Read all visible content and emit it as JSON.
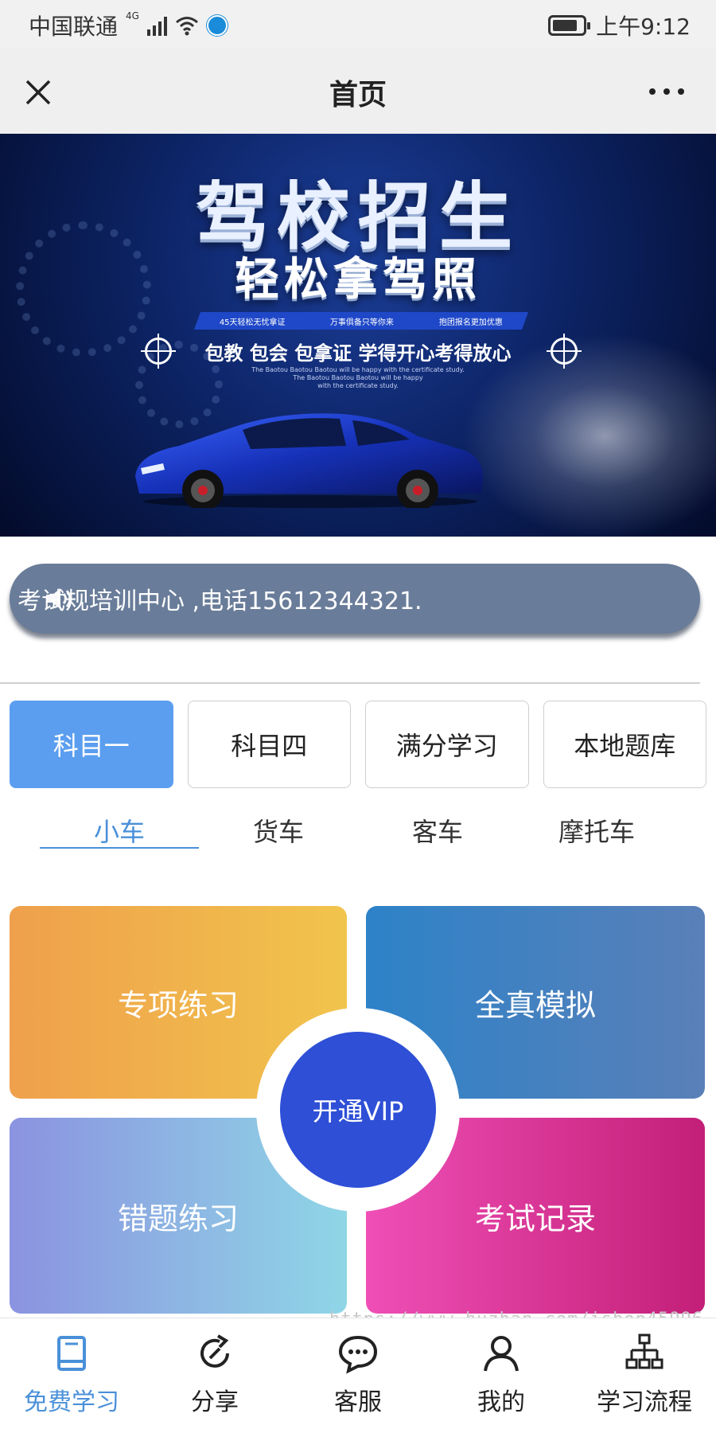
{
  "status_bar": {
    "carrier": "中国联通",
    "network": "4G",
    "time": "上午9:12"
  },
  "header": {
    "title": "首页",
    "close_icon": "close-icon",
    "more_icon": "more-icon"
  },
  "banner": {
    "title": "驾校招生",
    "subtitle": "轻松拿驾照",
    "tags": [
      "45天轻松无忧拿证",
      "万事俱备只等你来",
      "抱团报名更加优惠"
    ],
    "slogan": "包教 包会 包拿证 学得开心考得放心",
    "english_lines": [
      "The Baotou Baotou Baotou will be happy with the certificate study.",
      "The Baotou Baotou Baotou will be happy",
      "with the certificate study."
    ]
  },
  "notice": {
    "text": "考试规培训中心 ,电话15612344321.",
    "icon": "speaker-icon"
  },
  "subject_tabs": [
    {
      "label": "科目一",
      "active": true
    },
    {
      "label": "科目四",
      "active": false
    },
    {
      "label": "满分学习",
      "active": false
    },
    {
      "label": "本地题库",
      "active": false
    }
  ],
  "vehicle_tabs": [
    {
      "label": "小车",
      "active": true
    },
    {
      "label": "货车",
      "active": false
    },
    {
      "label": "客车",
      "active": false
    },
    {
      "label": "摩托车",
      "active": false
    }
  ],
  "cards": {
    "special_practice": "专项练习",
    "full_simulation": "全真模拟",
    "wrong_practice": "错题练习",
    "exam_records": "考试记录",
    "vip": "开通VIP"
  },
  "watermark": "https://www.huzhan.com/ishop45996",
  "colors": {
    "accent_blue": "#4a90d9",
    "tab_active_bg": "#5b9eef",
    "notice_bg": "#697c99",
    "vip_bg": "#2e4fd6"
  },
  "bottom_nav": [
    {
      "label": "免费学习",
      "icon": "book-icon",
      "active": true
    },
    {
      "label": "分享",
      "icon": "share-icon",
      "active": false
    },
    {
      "label": "客服",
      "icon": "chat-icon",
      "active": false
    },
    {
      "label": "我的",
      "icon": "user-icon",
      "active": false
    },
    {
      "label": "学习流程",
      "icon": "flowchart-icon",
      "active": false
    }
  ]
}
